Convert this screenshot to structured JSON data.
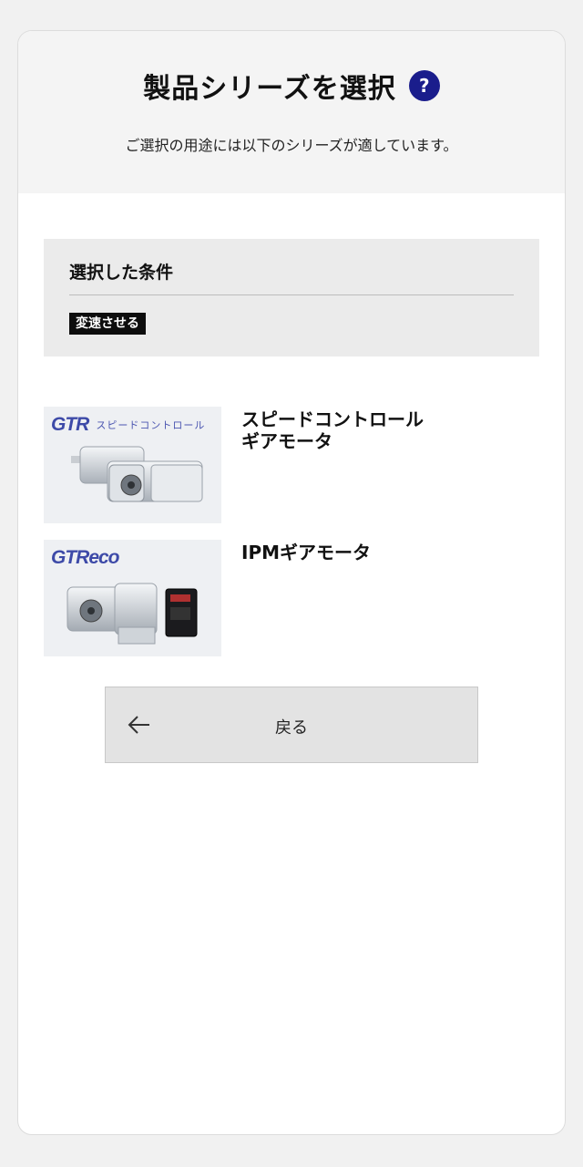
{
  "header": {
    "title": "製品シリーズを選択",
    "help_label": "?",
    "subtitle": "ご選択の用途には以下のシリーズが適しています。"
  },
  "conditions": {
    "title": "選択した条件",
    "tags": [
      "変速させる"
    ]
  },
  "products": [
    {
      "brand_logo": "GTR",
      "brand_sub": "スピードコントロール",
      "name": "スピードコントロール\nギアモータ"
    },
    {
      "brand_logo": "GTReco",
      "brand_sub": "",
      "name": "IPMギアモータ"
    }
  ],
  "back_button": {
    "label": "戻る",
    "icon": "arrow-left-icon"
  },
  "colors": {
    "accent": "#1a1d8c",
    "brand": "#3d4aa8",
    "tag_bg": "#0d0d0d"
  }
}
